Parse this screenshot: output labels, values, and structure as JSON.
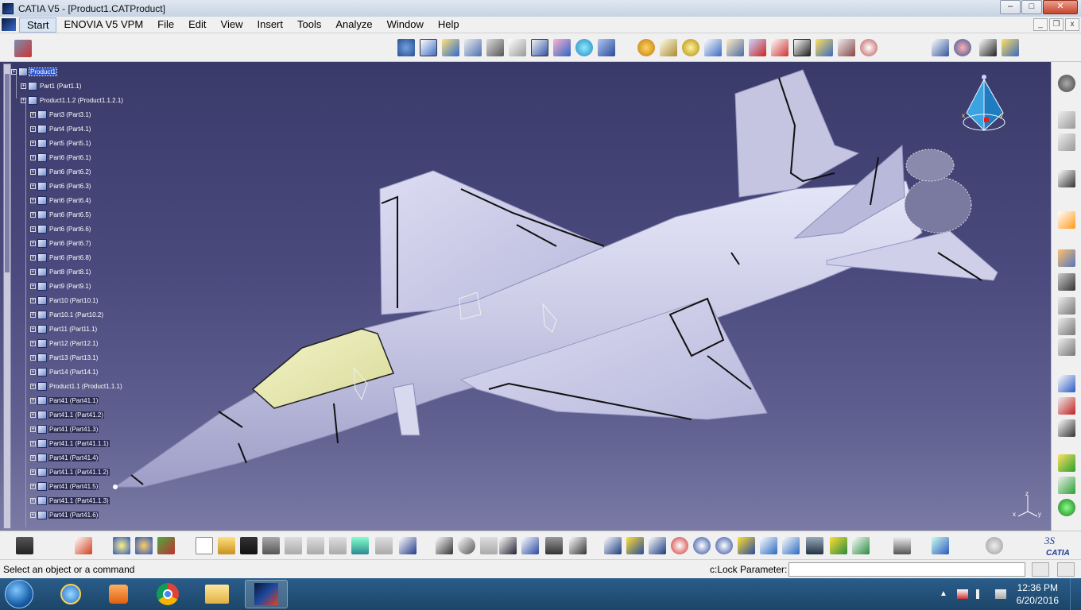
{
  "window": {
    "title": "CATIA V5 - [Product1.CATProduct]",
    "minimize": "–",
    "maximize": "□",
    "close": "✕"
  },
  "menu": {
    "items": [
      "Start",
      "ENOVIA V5 VPM",
      "File",
      "Edit",
      "View",
      "Insert",
      "Tools",
      "Analyze",
      "Window",
      "Help"
    ]
  },
  "tree": {
    "rows": [
      {
        "label": "Product1",
        "level": 0,
        "state": "selected"
      },
      {
        "label": "Part1 (Part1.1)",
        "level": 1,
        "state": ""
      },
      {
        "label": "Product1.1.2 (Product1.1.2.1)",
        "level": 1,
        "state": ""
      },
      {
        "label": "Part3 (Part3.1)",
        "level": 2,
        "state": ""
      },
      {
        "label": "Part4 (Part4.1)",
        "level": 2,
        "state": ""
      },
      {
        "label": "Part5 (Part5.1)",
        "level": 2,
        "state": ""
      },
      {
        "label": "Part6 (Part6.1)",
        "level": 2,
        "state": ""
      },
      {
        "label": "Part6 (Part6.2)",
        "level": 2,
        "state": ""
      },
      {
        "label": "Part6 (Part6.3)",
        "level": 2,
        "state": ""
      },
      {
        "label": "Part6 (Part6.4)",
        "level": 2,
        "state": ""
      },
      {
        "label": "Part6 (Part6.5)",
        "level": 2,
        "state": ""
      },
      {
        "label": "Part6 (Part6.6)",
        "level": 2,
        "state": ""
      },
      {
        "label": "Part6 (Part6.7)",
        "level": 2,
        "state": ""
      },
      {
        "label": "Part6 (Part6.8)",
        "level": 2,
        "state": ""
      },
      {
        "label": "Part8 (Part8.1)",
        "level": 2,
        "state": ""
      },
      {
        "label": "Part9 (Part9.1)",
        "level": 2,
        "state": ""
      },
      {
        "label": "Part10 (Part10.1)",
        "level": 2,
        "state": ""
      },
      {
        "label": "Part10.1 (Part10.2)",
        "level": 2,
        "state": ""
      },
      {
        "label": "Part11 (Part11.1)",
        "level": 2,
        "state": ""
      },
      {
        "label": "Part12 (Part12.1)",
        "level": 2,
        "state": ""
      },
      {
        "label": "Part13 (Part13.1)",
        "level": 2,
        "state": ""
      },
      {
        "label": "Part14 (Part14.1)",
        "level": 2,
        "state": ""
      },
      {
        "label": "Product1.1 (Product1.1.1)",
        "level": 2,
        "state": ""
      },
      {
        "label": "Part41 (Part41.1)",
        "level": 2,
        "state": "dark"
      },
      {
        "label": "Part41.1 (Part41.2)",
        "level": 2,
        "state": "dark"
      },
      {
        "label": "Part41 (Part41.3)",
        "level": 2,
        "state": "dark"
      },
      {
        "label": "Part41.1 (Part41.1.1)",
        "level": 2,
        "state": "dark"
      },
      {
        "label": "Part41 (Part41.4)",
        "level": 2,
        "state": "dark"
      },
      {
        "label": "Part41.1 (Part41.1.2)",
        "level": 2,
        "state": "dark"
      },
      {
        "label": "Part41 (Part41.5)",
        "level": 2,
        "state": "dark"
      },
      {
        "label": "Part41.1 (Part41.1.3)",
        "level": 2,
        "state": "dark"
      },
      {
        "label": "Part41 (Part41.6)",
        "level": 2,
        "state": "dark"
      }
    ]
  },
  "compass": {
    "x_label": "x",
    "y_label": "y"
  },
  "axis_triad": {
    "x": "x",
    "y": "y",
    "z": "z"
  },
  "status": {
    "message": "Select an object or a command",
    "param_label": "c:Lock Parameter:",
    "param_value": ""
  },
  "taskbar": {
    "time": "12:36 PM",
    "date": "6/20/2016"
  },
  "catia_brand": "CATIA"
}
